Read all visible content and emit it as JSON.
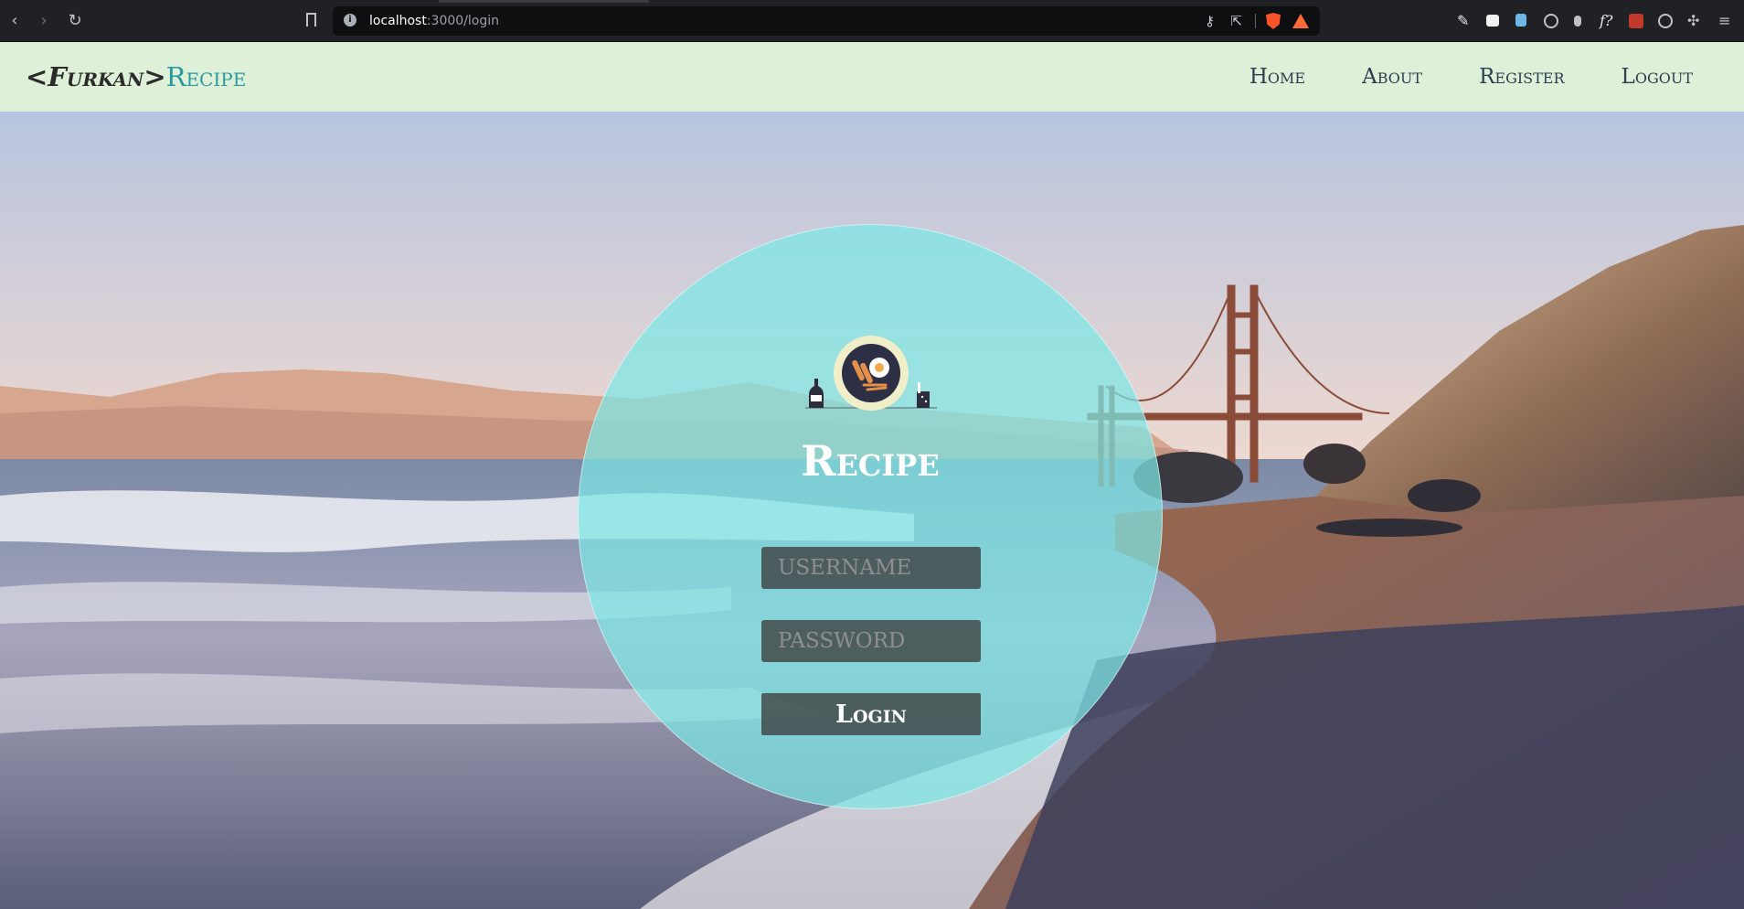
{
  "browser": {
    "url_host": "localhost",
    "url_path": ":3000/login"
  },
  "navbar": {
    "logo_main": "<Furkan>",
    "logo_accent": "Recipe",
    "links": [
      "Home",
      "About",
      "Register",
      "Logout"
    ]
  },
  "login": {
    "brand": "Recipe",
    "username_placeholder": "USERNAME",
    "password_placeholder": "PASSWORD",
    "button_label": "Login"
  },
  "colors": {
    "navbar_bg": "#def0d8",
    "accent": "#2a9aa0",
    "circle": "#7de8e6"
  },
  "icons": [
    "back-icon",
    "forward-icon",
    "reload-icon",
    "bookmark-icon",
    "info-icon",
    "key-icon",
    "share-icon",
    "brave-shield-icon",
    "brave-rewards-icon",
    "extension-icons",
    "menu-icon",
    "recipe-illustration"
  ]
}
